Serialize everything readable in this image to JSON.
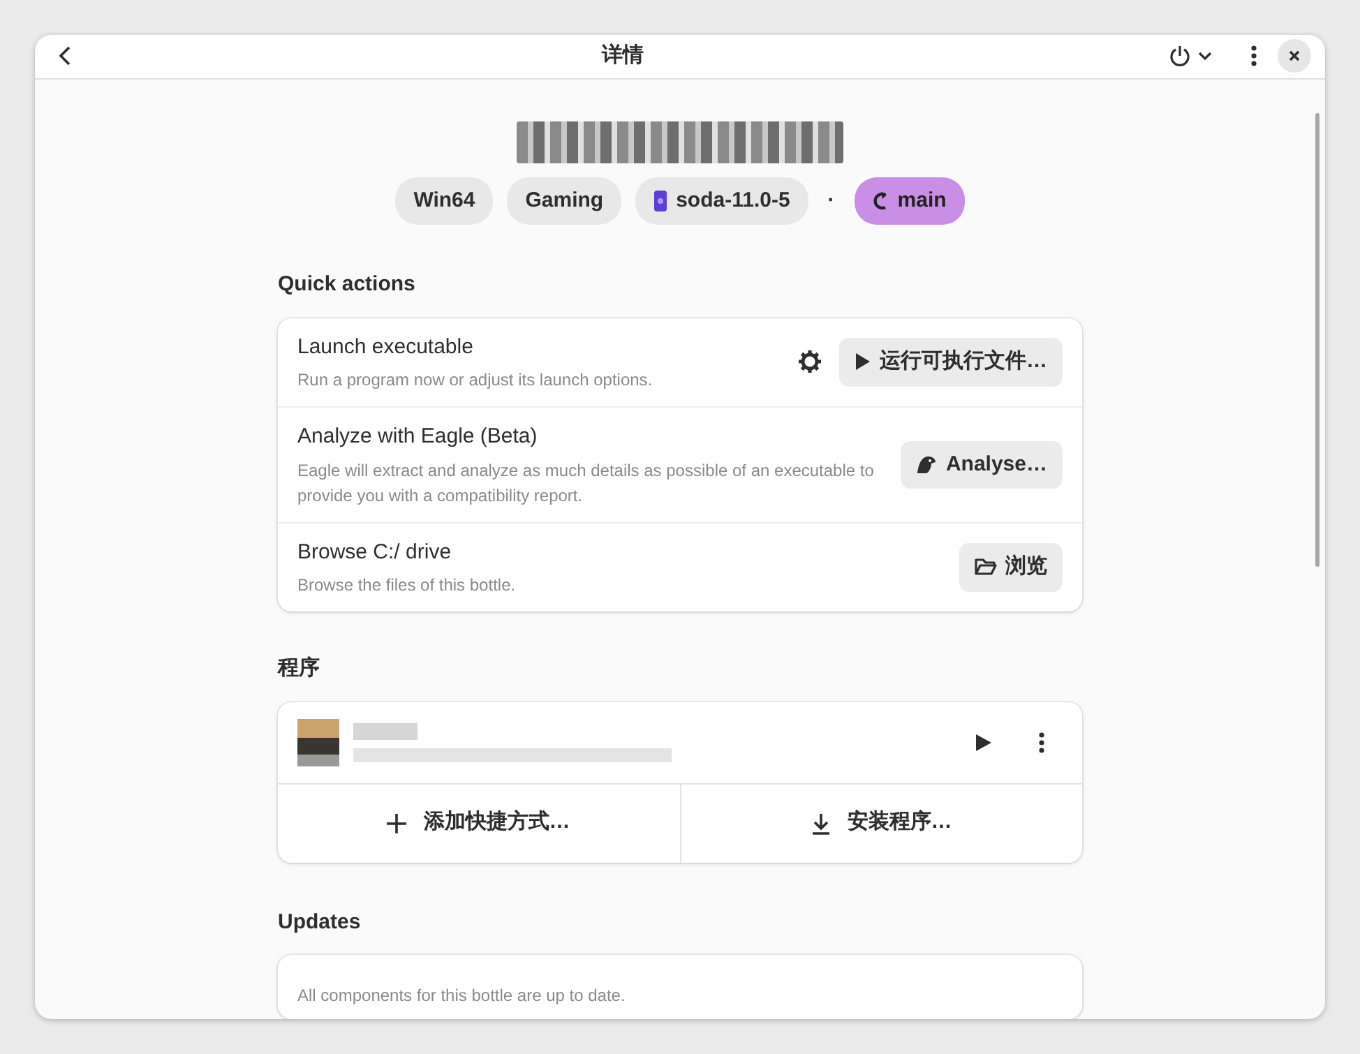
{
  "window": {
    "title": "详情"
  },
  "tags": [
    {
      "label": "Win64",
      "kind": "plain"
    },
    {
      "label": "Gaming",
      "kind": "plain"
    },
    {
      "label": "soda-11.0-5",
      "kind": "runner"
    },
    {
      "label": "·",
      "kind": "separator"
    },
    {
      "label": "main",
      "kind": "branch"
    }
  ],
  "quick_actions": {
    "heading": "Quick actions",
    "rows": [
      {
        "kind": "launch",
        "title": "Launch executable",
        "subtitle": "Run a program now or adjust its launch options.",
        "button": "运行可执行文件…"
      },
      {
        "kind": "analyze",
        "title": "Analyze with Eagle (Beta)",
        "subtitle": "Eagle will extract and analyze as much details as possible of an executable to provide you with a compatibility report.",
        "button": "Analyse…"
      },
      {
        "kind": "browse",
        "title": "Browse C:/ drive",
        "subtitle": "Browse the files of this bottle.",
        "button": "浏览"
      }
    ]
  },
  "programs": {
    "heading": "程序",
    "footer": [
      {
        "kind": "add",
        "label": "添加快捷方式…"
      },
      {
        "kind": "download",
        "label": "安装程序…"
      }
    ]
  },
  "updates": {
    "heading": "Updates",
    "message": "All components for this bottle are up to date."
  }
}
